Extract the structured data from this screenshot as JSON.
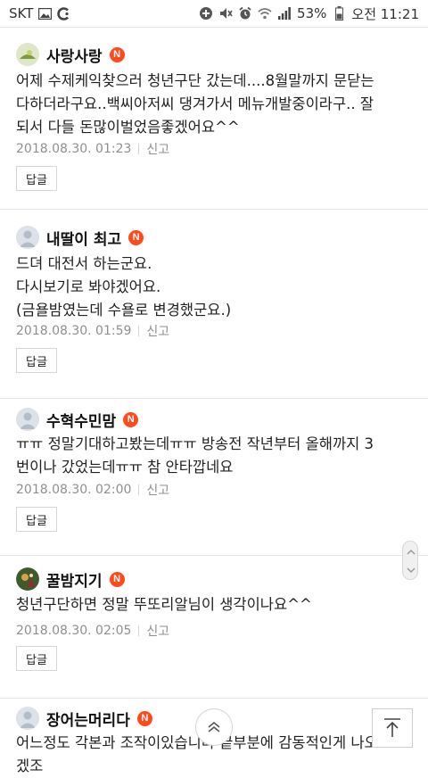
{
  "status_bar": {
    "carrier": "SKT",
    "battery": "53%",
    "time": "오전 11:21",
    "icons": [
      "gallery-icon",
      "c-app-icon",
      "add-circle-icon",
      "mute-icon",
      "alarm-icon",
      "wifi-icon",
      "signal-icon",
      "battery-icon"
    ]
  },
  "comments": [
    {
      "nickname": "사랑사랑",
      "badge": "N",
      "lines": [
        "어제 수제케익찾으러 청년구단 갔는데....8월말까지 문닫는",
        "다하더라구요..백씨아저씨 댕겨가서 메뉴개발중이라구.. 잘",
        "되서 다들 돈많이벌었음좋겠어요^^"
      ],
      "date": "2018.08.30. 01:23",
      "report": "신고",
      "reply": "답글"
    },
    {
      "nickname": "내딸이 최고",
      "badge": "N",
      "lines": [
        "드뎌 대전서 하는군요.",
        "다시보기로 봐야겠어요.",
        "(금욜밤였는데 수욜로 변경했군요.)"
      ],
      "date": "2018.08.30. 01:59",
      "report": "신고",
      "reply": "답글"
    },
    {
      "nickname": "수혁수민맘",
      "badge": "N",
      "lines": [
        "ㅠㅠ 정말기대하고봤는데ㅠㅠ 방송전 작년부터 올해까지 3",
        "번이나 갔었는데ㅠㅠ 참 안타깝네요"
      ],
      "date": "2018.08.30. 02:00",
      "report": "신고",
      "reply": "답글"
    },
    {
      "nickname": "꿀밤지기",
      "badge": "N",
      "lines": [
        "청년구단하면 정말 뚜또리알님이 생각이나요^^"
      ],
      "date": "2018.08.30. 02:05",
      "report": "신고",
      "reply": "답글"
    },
    {
      "nickname": "장어는머리다",
      "badge": "N",
      "lines": [
        "어느정도 각본과 조작이있습니다 끝부분에 감동적인게 나오",
        "겠조"
      ]
    }
  ]
}
